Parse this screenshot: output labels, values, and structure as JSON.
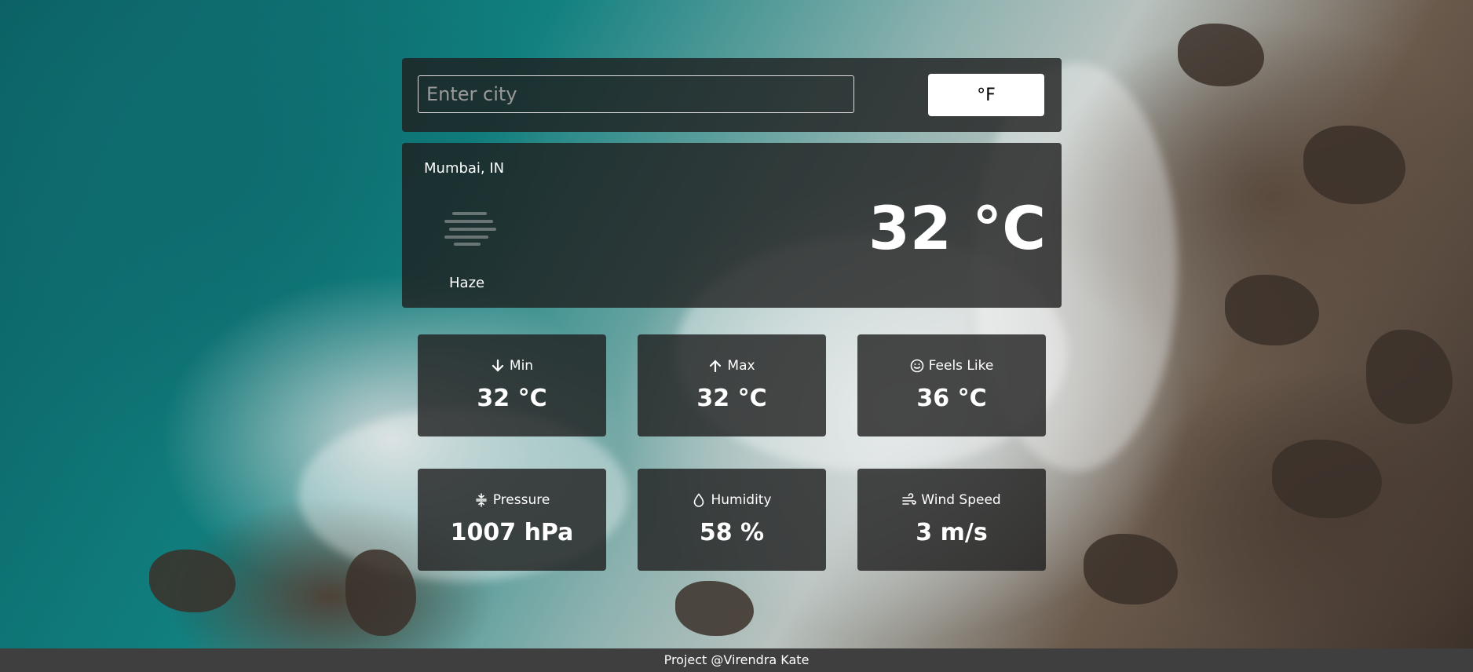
{
  "search": {
    "placeholder": "Enter city",
    "value": ""
  },
  "unit_toggle": {
    "label": "°F"
  },
  "current": {
    "location": "Mumbai, IN",
    "temperature": "32 °C",
    "condition": "Haze",
    "icon": "haze-icon"
  },
  "stats": [
    {
      "label": "Min",
      "value": "32 °C",
      "icon": "arrow-down-icon"
    },
    {
      "label": "Max",
      "value": "32 °C",
      "icon": "arrow-up-icon"
    },
    {
      "label": "Feels Like",
      "value": "36 °C",
      "icon": "smile-icon"
    },
    {
      "label": "Pressure",
      "value": "1007 hPa",
      "icon": "pressure-icon"
    },
    {
      "label": "Humidity",
      "value": "58 %",
      "icon": "droplet-icon"
    },
    {
      "label": "Wind Speed",
      "value": "3 m/s",
      "icon": "wind-icon"
    }
  ],
  "footer": {
    "text": "Project @Virendra Kate"
  },
  "colors": {
    "card_bg": "#1e1e1e",
    "footer_bg": "#3f3f3f",
    "text": "#ffffff"
  }
}
